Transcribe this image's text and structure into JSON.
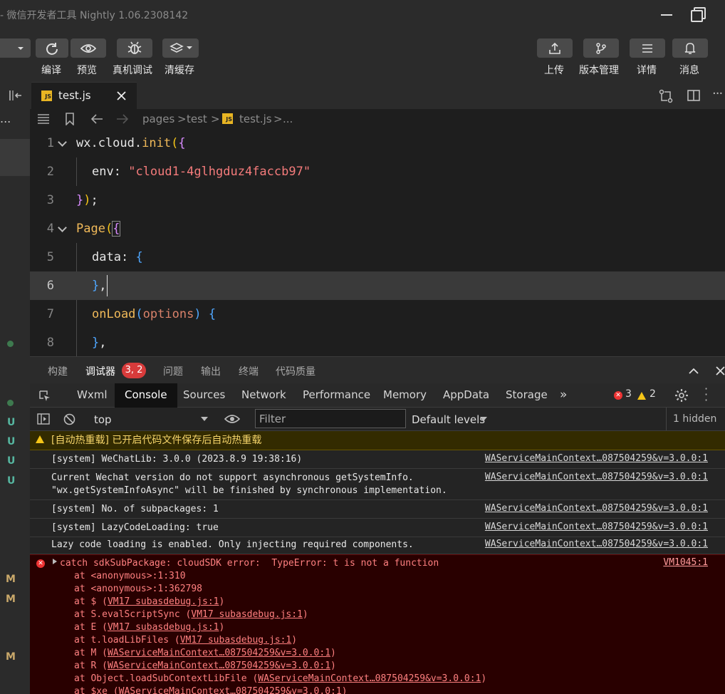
{
  "window": {
    "title": "- 微信开发者工具 Nightly 1.06.2308142"
  },
  "toolbar": {
    "compile_label": "编译",
    "preview_label": "预览",
    "real_debug_label": "真机调试",
    "clear_cache_label": "清缓存",
    "upload_label": "上传",
    "version_label": "版本管理",
    "details_label": "详情",
    "messages_label": "消息"
  },
  "editor": {
    "tab_label": "test.js",
    "tab_icon": "JS",
    "breadcrumb": {
      "part1": "pages",
      "part2": "test",
      "file": "test.js",
      "more": "..."
    },
    "lines": [
      {
        "n": "1",
        "code": [
          "wx.cloud.",
          "init",
          "(",
          "{"
        ]
      },
      {
        "n": "2",
        "code": [
          "env",
          ": ",
          "\"cloud1-4glhgduz4faccb97\""
        ]
      },
      {
        "n": "3",
        "code": [
          "}",
          ")",
          ";"
        ]
      },
      {
        "n": "4",
        "code": [
          "Page",
          "(",
          "{"
        ]
      },
      {
        "n": "5",
        "code": [
          "data",
          ": ",
          "{"
        ]
      },
      {
        "n": "6",
        "code": [
          "}",
          ","
        ]
      },
      {
        "n": "7",
        "code": [
          "onLoad",
          "(",
          "options",
          ") ",
          "{"
        ]
      },
      {
        "n": "8",
        "code": [
          "}",
          ","
        ]
      }
    ]
  },
  "panel": {
    "tabs": {
      "build": "构建",
      "debugger": "调试器",
      "debugger_badge": "3, 2",
      "problems": "问题",
      "output": "输出",
      "terminal": "终端",
      "code_quality": "代码质量"
    }
  },
  "devtools": {
    "tabs": {
      "wxml": "Wxml",
      "console": "Console",
      "sources": "Sources",
      "network": "Network",
      "performance": "Performance",
      "memory": "Memory",
      "appdata": "AppData",
      "storage": "Storage"
    },
    "error_count": "3",
    "warning_count": "2"
  },
  "console": {
    "context": "top",
    "filter_placeholder": "Filter",
    "levels": "Default levels",
    "hidden": "1 hidden",
    "messages": [
      {
        "type": "warn",
        "text": "[自动热重载] 已开启代码文件保存后自动热重载",
        "source": ""
      },
      {
        "type": "log",
        "text": "[system] WeChatLib: 3.0.0 (2023.8.9 19:38:16)",
        "source": "WAServiceMainContext…087504259&v=3.0.0:1"
      },
      {
        "type": "log",
        "text": "Current Wechat version do not support asynchronous getSystemInfo.",
        "text2": "\"wx.getSystemInfoAsync\" will be finished by synchronous implementation.",
        "source": "WAServiceMainContext…087504259&v=3.0.0:1"
      },
      {
        "type": "log",
        "text": "[system] No. of subpackages: 1",
        "source": "WAServiceMainContext…087504259&v=3.0.0:1"
      },
      {
        "type": "log",
        "text": "[system] LazyCodeLoading: true",
        "source": "WAServiceMainContext…087504259&v=3.0.0:1"
      },
      {
        "type": "log",
        "text": "Lazy code loading is enabled. Only injecting required components.",
        "source": "WAServiceMainContext…087504259&v=3.0.0:1"
      }
    ],
    "error": {
      "text": "catch sdkSubPackage: cloudSDK error:  TypeError: t is not a function",
      "source": "VM1045:1",
      "stack": [
        {
          "pre": "at <anonymous>:1:310",
          "link": "",
          "post": ""
        },
        {
          "pre": "at <anonymous>:1:362798",
          "link": "",
          "post": ""
        },
        {
          "pre": "at $ (",
          "link": "VM17 subasdebug.js:1",
          "post": ")"
        },
        {
          "pre": "at S.evalScriptSync (",
          "link": "VM17 subasdebug.js:1",
          "post": ")"
        },
        {
          "pre": "at E (",
          "link": "VM17 subasdebug.js:1",
          "post": ")"
        },
        {
          "pre": "at t.loadLibFiles (",
          "link": "VM17 subasdebug.js:1",
          "post": ")"
        },
        {
          "pre": "at M (",
          "link": "WAServiceMainContext…087504259&v=3.0.0:1",
          "post": ")"
        },
        {
          "pre": "at R (",
          "link": "WAServiceMainContext…087504259&v=3.0.0:1",
          "post": ")"
        },
        {
          "pre": "at Object.loadSubContextLibFile (",
          "link": "WAServiceMainContext…087504259&v=3.0.0:1",
          "post": ")"
        },
        {
          "pre": "at $xe (",
          "link": "WAServiceMainContext…087504259&v=3.0.0:1",
          "post": ")"
        }
      ]
    }
  },
  "gutter": {
    "u": "U",
    "m": "M",
    "dots": "..."
  }
}
